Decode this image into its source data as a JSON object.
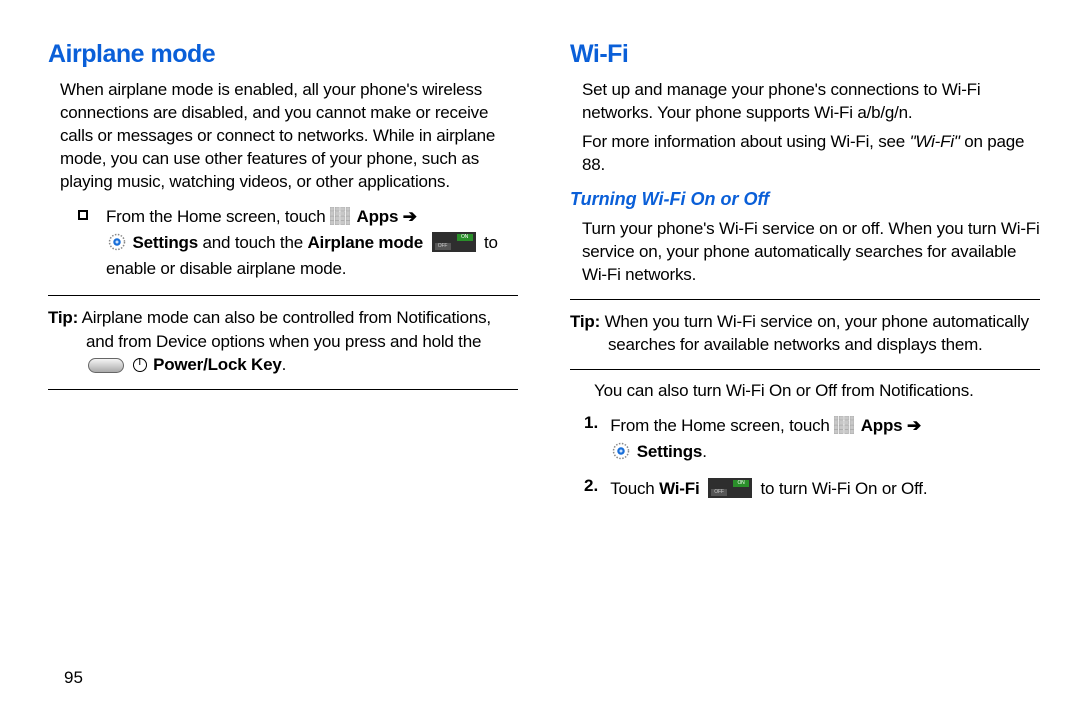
{
  "left": {
    "heading": "Airplane mode",
    "intro": "When airplane mode is enabled, all your phone's wireless connections are disabled, and you cannot make or receive calls or messages or connect to networks. While in airplane mode, you can use other features of your phone, such as playing music, watching videos, or other applications.",
    "bullet1_a": "From the Home screen, touch ",
    "bullet1_apps": "Apps",
    "bullet1_settings_pre": " ",
    "bullet1_settings": "Settings",
    "bullet1_after": " and touch the ",
    "bullet1_airplane": "Airplane mode",
    "bullet1_end": " to enable or disable airplane mode.",
    "tip_label": "Tip:",
    "tip_text_a": "Airplane mode can also be controlled from Notifications, and from Device options when you press and hold the ",
    "tip_powerkey": "Power/Lock Key",
    "tip_period": "."
  },
  "right": {
    "heading": "Wi-Fi",
    "intro1": "Set up and manage your phone's connections to Wi-Fi networks. Your phone supports Wi-Fi a/b/g/n.",
    "intro2_a": "For more information about using Wi-Fi, see ",
    "intro2_i": "\"Wi-Fi\"",
    "intro2_b": " on page 88.",
    "subhead": "Turning Wi-Fi On or Off",
    "sub_p": "Turn your phone's Wi-Fi service on or off. When you turn Wi-Fi service on, your phone automatically searches for available Wi-Fi networks.",
    "tip_label": "Tip:",
    "tip_text": "When you turn Wi-Fi service on, your phone automatically searches for available networks and displays them.",
    "after_tip": "You can also turn Wi-Fi On or Off from Notifications.",
    "step1_a": "From the Home screen, touch ",
    "step1_apps": "Apps",
    "step1_settings": "Settings",
    "step1_period": ".",
    "step2_a": "Touch ",
    "step2_wifi": "Wi-Fi",
    "step2_b": " to turn Wi-Fi On or Off.",
    "num1": "1.",
    "num2": "2."
  },
  "arrow": "➔",
  "pagenum": "95"
}
